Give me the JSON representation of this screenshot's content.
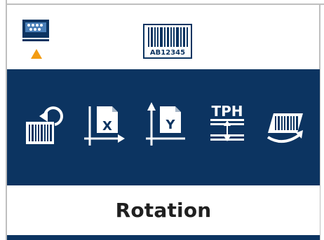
{
  "top_tabs": [
    {
      "id": "printer-settings",
      "icon": "printer-dots-icon",
      "selected": true,
      "marker_color": "#f39c12"
    },
    {
      "id": "barcode-settings",
      "icon": "barcode-icon",
      "selected": false,
      "code_text": "AB12345"
    }
  ],
  "menu_items": [
    {
      "id": "rotation",
      "icon": "rotate-barcode-icon"
    },
    {
      "id": "x-offset",
      "icon": "x-offset-icon",
      "glyph": "X"
    },
    {
      "id": "y-offset",
      "icon": "y-offset-icon",
      "glyph": "Y"
    },
    {
      "id": "tph",
      "icon": "tph-adjust-icon",
      "text": "TPH"
    },
    {
      "id": "mirror",
      "icon": "flip-barcode-icon"
    }
  ],
  "current_label": "Rotation",
  "colors": {
    "menu_bg": "#0c3461",
    "icon": "#ffffff",
    "marker": "#f39c12",
    "label_text": "#202020",
    "frame": "#bfbfbf"
  }
}
